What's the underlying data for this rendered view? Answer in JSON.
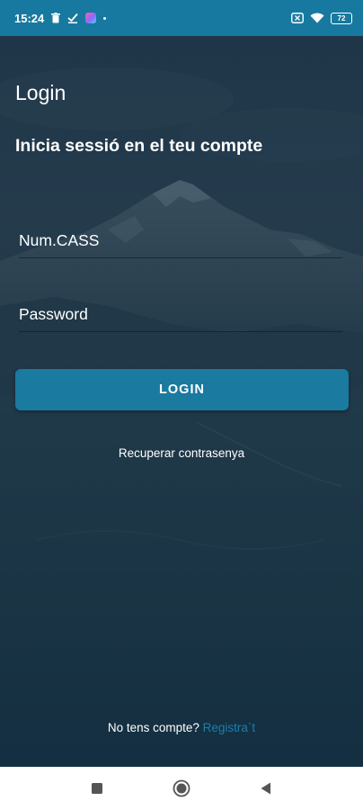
{
  "status_bar": {
    "time": "15:24",
    "battery": "72",
    "icons_left": [
      "delete-icon",
      "download-done-icon",
      "app-notification-icon",
      "dot-icon"
    ],
    "icons_right": [
      "sim-off-icon",
      "wifi-icon",
      "battery-icon"
    ],
    "background_color": "#17799f"
  },
  "header": {
    "title": "Login",
    "subtitle": "Inicia sessió en el teu compte"
  },
  "form": {
    "username_placeholder": "Num.CASS",
    "username_value": "",
    "password_placeholder": "Password",
    "password_value": "",
    "login_label": "LOGIN",
    "recover_label": "Recuperar contrasenya"
  },
  "footer": {
    "no_account_text": "No tens compte?",
    "register_label": "Registra`t"
  },
  "nav_bar": {
    "icons": [
      "recents-icon",
      "home-icon",
      "back-icon"
    ]
  },
  "colors": {
    "accent": "#1a7aa0",
    "link": "#1a7fab",
    "overlay": "#1b3547"
  }
}
